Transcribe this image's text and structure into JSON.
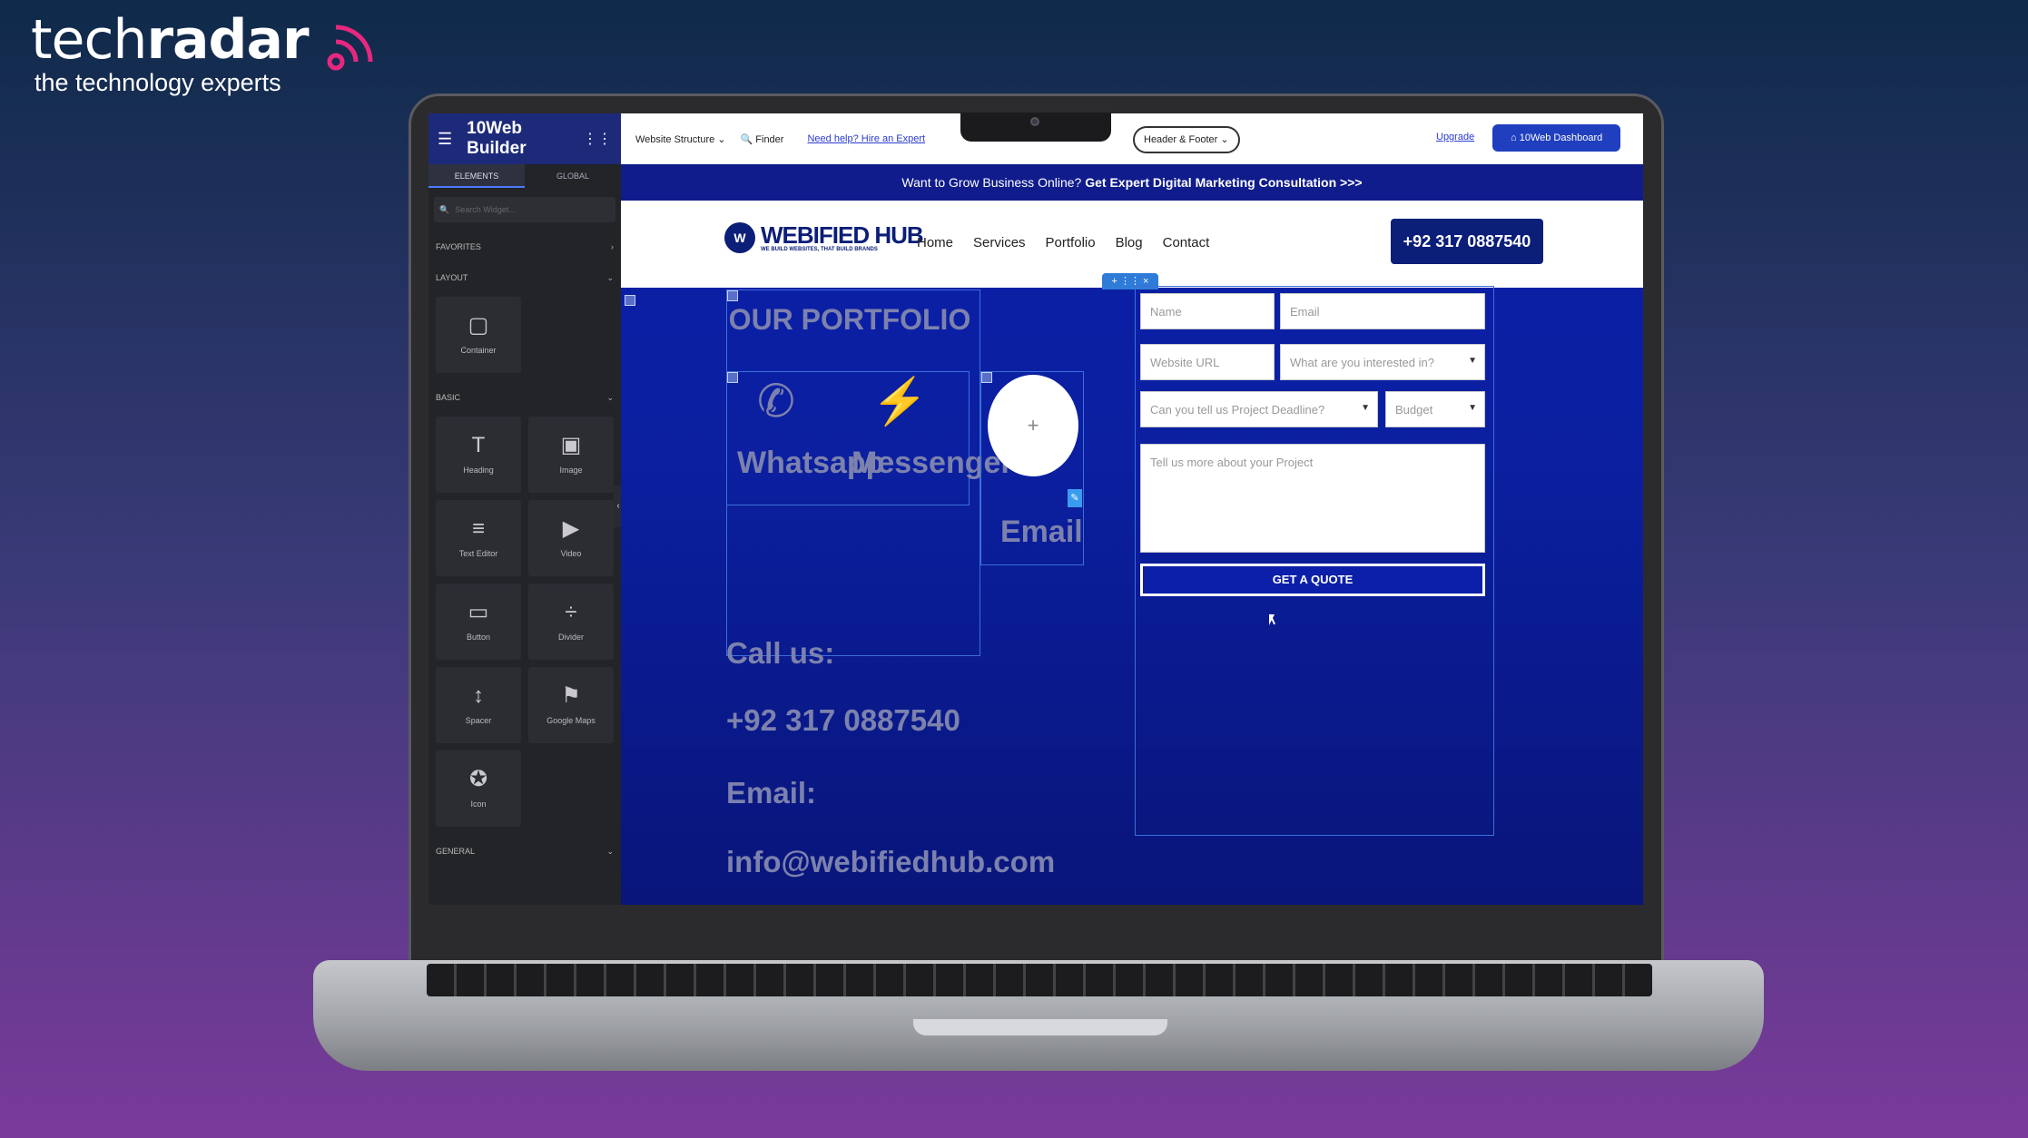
{
  "brand": {
    "wordmark_a": "tech",
    "wordmark_b": "radar",
    "tagline": "the technology experts",
    "accent": "#e8277f"
  },
  "sidebar": {
    "title": "10Web Builder",
    "tabs": [
      "ELEMENTS",
      "GLOBAL"
    ],
    "search_placeholder": "Search Widget...",
    "sections": {
      "favorites": "FAVORITES",
      "layout": "LAYOUT",
      "basic": "BASIC",
      "general": "GENERAL"
    },
    "layout_widgets": [
      {
        "label": "Container",
        "icon": "container-icon"
      }
    ],
    "basic_widgets": [
      {
        "label": "Heading",
        "icon": "heading-icon"
      },
      {
        "label": "Image",
        "icon": "image-icon"
      },
      {
        "label": "Text Editor",
        "icon": "text-editor-icon"
      },
      {
        "label": "Video",
        "icon": "video-icon"
      },
      {
        "label": "Button",
        "icon": "button-icon"
      },
      {
        "label": "Divider",
        "icon": "divider-icon"
      },
      {
        "label": "Spacer",
        "icon": "spacer-icon"
      },
      {
        "label": "Google Maps",
        "icon": "google-maps-icon"
      },
      {
        "label": "Icon",
        "icon": "star-icon"
      }
    ]
  },
  "topbar": {
    "website_structure": "Website Structure",
    "finder": "Finder",
    "help_link": "Need help? Hire an Expert",
    "header_footer": "Header & Footer",
    "upgrade": "Upgrade",
    "dashboard": "10Web Dashboard"
  },
  "site": {
    "promo_text": "Want to Grow Business Online? ",
    "promo_bold": "Get Expert Digital Marketing Consultation >>>",
    "logo_name": "WEBIFIED HUB",
    "logo_tag": "WE BUILD WEBSITES, THAT BUILD BRANDS",
    "menu": [
      "Home",
      "Services",
      "Portfolio",
      "Blog",
      "Contact"
    ],
    "phone_button": "+92 317 0887540",
    "section_title": "OUR PORTFOLIO",
    "socials": [
      "Whatsapp",
      "Messenger",
      "Email"
    ],
    "call_label": "Call us:",
    "call_number": "+92 317 0887540",
    "email_label": "Email:",
    "email_value": "info@webifiedhub.com",
    "form": {
      "name": "Name",
      "email": "Email",
      "website": "Website URL",
      "interest": "What are you interested in?",
      "deadline": "Can you tell us Project Deadline?",
      "budget": "Budget",
      "message": "Tell us more about your Project",
      "submit": "GET A QUOTE"
    },
    "colors": {
      "brand_navy": "#0b1e78",
      "canvas_blue": "#0b1fa8",
      "accent_blue": "#1f3fbf"
    }
  }
}
